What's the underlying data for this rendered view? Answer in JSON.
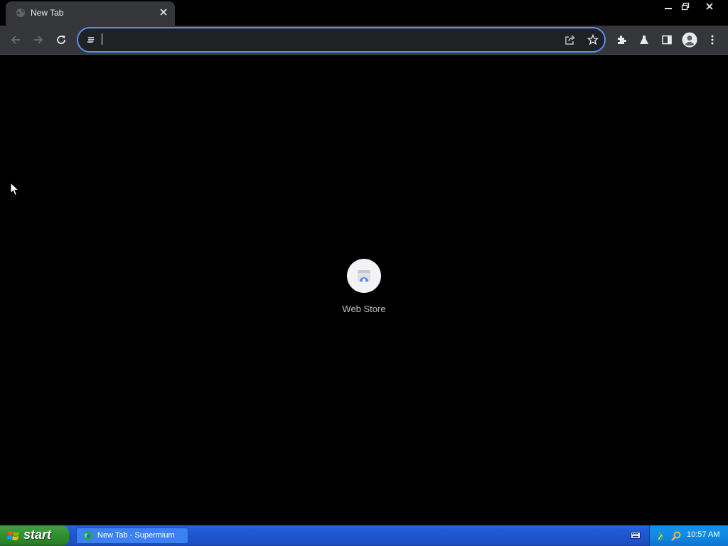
{
  "browser": {
    "tab": {
      "title": "New Tab"
    },
    "omnibox": {
      "value": "",
      "placeholder": ""
    },
    "accent_color": "#5b8ff0"
  },
  "icons": {
    "tab_favicon": "globe-icon",
    "tab_close": "close-icon",
    "minimize": "minimize-icon",
    "restore": "restore-icon",
    "close_window": "close-icon",
    "back": "back-arrow-icon",
    "forward": "forward-arrow-icon",
    "reload": "reload-icon",
    "site_info": "site-info-icon",
    "share": "share-icon",
    "bookmark": "star-icon",
    "extensions": "puzzle-icon",
    "labs": "flask-icon",
    "side_panel": "side-panel-icon",
    "profile": "profile-icon",
    "menu": "kebab-menu-icon"
  },
  "new_tab_page": {
    "shortcuts": [
      {
        "label": "Web Store",
        "icon": "web-store-icon"
      }
    ]
  },
  "taskbar": {
    "start_label": "start",
    "tasks": [
      {
        "label": "New Tab - Supermium",
        "icon": "browser-icon"
      }
    ],
    "clock": "10:57 AM",
    "colors": {
      "bar": "#245edb",
      "start": "#3c9a3c",
      "tray": "#0f8ae5"
    }
  }
}
